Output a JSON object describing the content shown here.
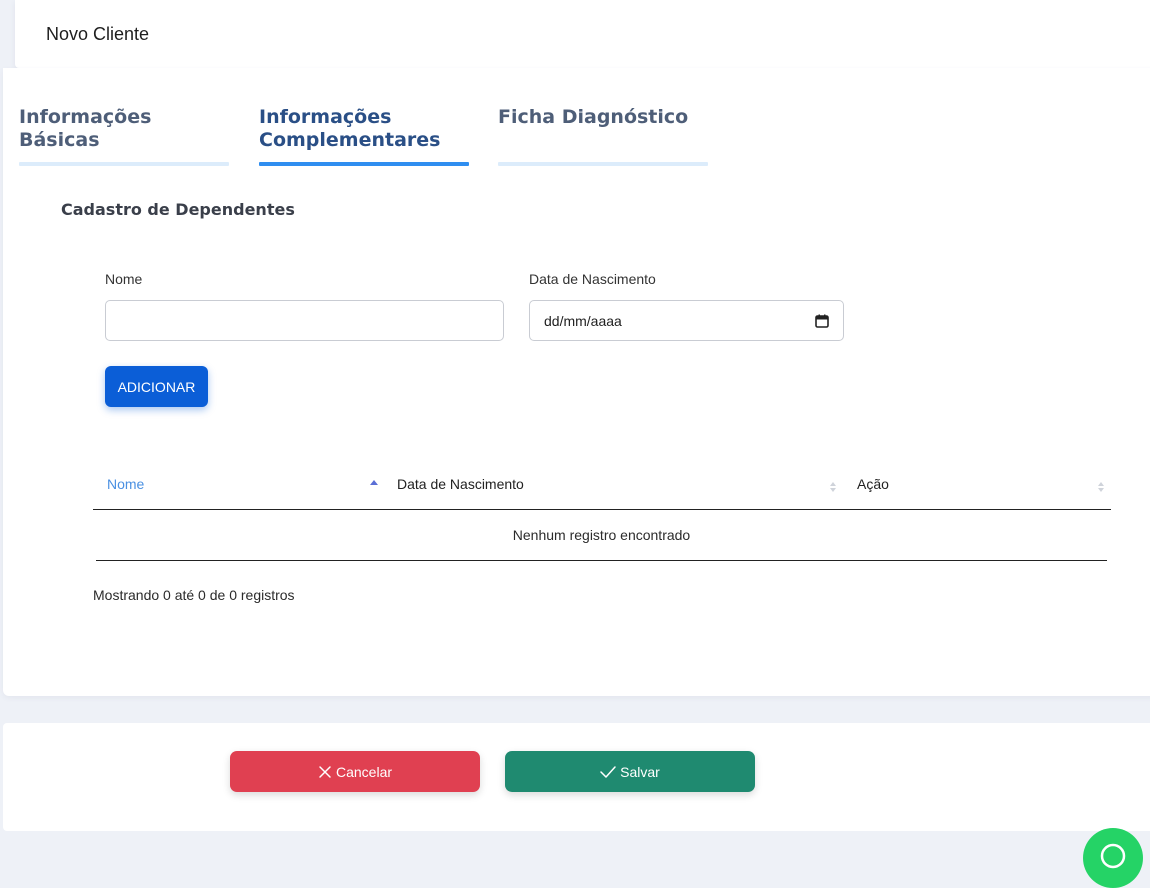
{
  "header": {
    "title": "Novo Cliente"
  },
  "tabs": [
    {
      "label": "Informações Básicas",
      "active": false
    },
    {
      "label": "Informações Complementares",
      "active": true
    },
    {
      "label": "Ficha Diagnóstico",
      "active": false
    }
  ],
  "section": {
    "title": "Cadastro de Dependentes"
  },
  "form": {
    "name_label": "Nome",
    "name_value": "",
    "birth_label": "Data de Nascimento",
    "birth_placeholder": "dd/mm/aaaa",
    "add_button": "ADICIONAR"
  },
  "table": {
    "columns": [
      "Nome",
      "Data de Nascimento",
      "Ação"
    ],
    "sorted_column": "Nome",
    "empty_message": "Nenhum registro encontrado",
    "info": "Mostrando 0 até 0 de 0 registros"
  },
  "footer": {
    "cancel_label": "Cancelar",
    "save_label": "Salvar"
  },
  "colors": {
    "accent": "#2f8ef0",
    "add_button": "#0b5ed7",
    "cancel": "#e04051",
    "save": "#1f8a70",
    "chat": "#25d366"
  },
  "icons": {
    "cancel": "close-icon",
    "save": "check-icon",
    "date": "calendar-icon",
    "chat": "whatsapp-icon"
  }
}
